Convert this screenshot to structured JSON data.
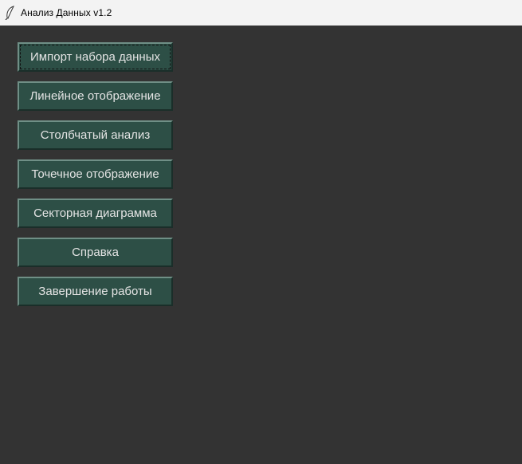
{
  "window": {
    "title": "Анализ Данных v1.2",
    "icon": "feather-icon"
  },
  "menu": {
    "buttons": [
      {
        "label": "Импорт набора данных",
        "focused": true
      },
      {
        "label": "Линейное отображение"
      },
      {
        "label": "Столбчатый анализ"
      },
      {
        "label": "Точечное отображение"
      },
      {
        "label": "Секторная диаграмма"
      },
      {
        "label": "Справка"
      },
      {
        "label": "Завершение работы"
      }
    ]
  },
  "colors": {
    "background": "#333333",
    "button_bg": "#2d4f46",
    "button_text": "#e4e4e4",
    "titlebar_bg": "#f3f3f3"
  }
}
